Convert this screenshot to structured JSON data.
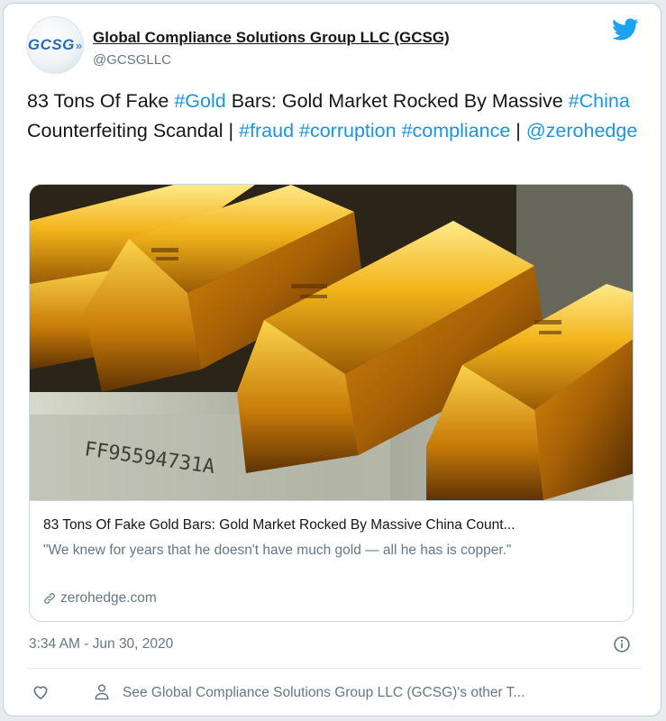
{
  "author": {
    "name": "Global Compliance Solutions Group LLC (GCSG)",
    "handle": "@GCSGLLC",
    "avatar_text": "GCSG",
    "avatar_arrows": "»"
  },
  "tweet": {
    "parts": [
      {
        "text": "83 Tons Of Fake ",
        "type": "text"
      },
      {
        "text": "#Gold",
        "type": "link"
      },
      {
        "text": " Bars: Gold Market Rocked By Massive ",
        "type": "text"
      },
      {
        "text": "#China",
        "type": "link"
      },
      {
        "text": " Counterfeiting Scandal | ",
        "type": "text"
      },
      {
        "text": "#fraud",
        "type": "link"
      },
      {
        "text": " ",
        "type": "text"
      },
      {
        "text": "#corruption",
        "type": "link"
      },
      {
        "text": " ",
        "type": "text"
      },
      {
        "text": "#compliance",
        "type": "link"
      },
      {
        "text": " | ",
        "type": "text"
      },
      {
        "text": "@zerohedge",
        "type": "link"
      }
    ]
  },
  "card": {
    "title": "83 Tons Of Fake Gold Bars: Gold Market Rocked By Massive China Count...",
    "description": "\"We knew for years that he doesn't have much gold — all he has is copper.\"",
    "domain": "zerohedge.com",
    "image_text": "FF95594731A"
  },
  "timestamp": "3:34 AM - Jun 30, 2020",
  "footer": {
    "see_other": "See Global Compliance Solutions Group LLC (GCSG)'s other T..."
  },
  "colors": {
    "link": "#1b95e0",
    "twitter_blue": "#1da1f2",
    "muted": "#657786"
  },
  "icons": [
    "twitter-bird-icon",
    "link-icon",
    "info-icon",
    "heart-icon",
    "person-icon"
  ]
}
